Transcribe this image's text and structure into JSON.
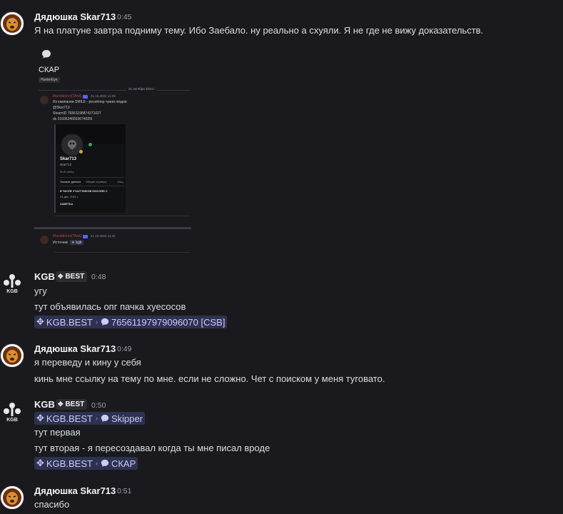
{
  "messages": [
    {
      "author": "Дядюшка Skar713",
      "time": "0:45",
      "lines": [
        "Я на платуне завтра подниму тему. Ибо Заебало. ну реально а схуяли. Я не где не вижу доказательств."
      ]
    },
    {
      "author": "KGB",
      "badge": "BEST",
      "time": "0:48",
      "lines": [
        "угу",
        "тут объявилась опг пачка хуесосов"
      ],
      "chip": {
        "server": "KGB.BEST",
        "channel": "76561197979096070 [CSB]"
      }
    },
    {
      "author": "Дядюшка Skar713",
      "time": "0:49",
      "lines": [
        "я переведу и кину у себя",
        "кинь мне ссылку на тему по мне. если не сложно. Чет с поиском у меня туговато."
      ]
    },
    {
      "author": "KGB",
      "badge": "BEST",
      "time": "0:50",
      "chip_top": {
        "server": "KGB.BEST",
        "channel": "Skipper"
      },
      "lines": [
        "тут первая",
        "тут вторая - я пересоздавал когда ты мне писал вроде"
      ],
      "chip": {
        "server": "KGB.BEST",
        "channel": "СКАР"
      }
    },
    {
      "author": "Дядюшка Skar713",
      "time": "0:51",
      "lines": [
        "спасибо"
      ]
    }
  ],
  "embed": {
    "channel_name": "СКАР",
    "tag": "HunterEye",
    "date_divider": "21 октября 2024 г.",
    "msg1_author": "Mandalorec[TAnk]",
    "msg1_time": "21.10.2024 11:09",
    "msg1_lines": [
      "Из кампании SMILE - ресейлер чужих модов",
      "@Skar713",
      "SteamID 76561198874371027",
      "ds 3193624656367452I6"
    ],
    "profile_name": "Skar713",
    "profile_handle": "skar713",
    "profile_sub": "Мой сабер",
    "profile_tabs": [
      "Личные данные",
      "Общие сервера",
      "Общ"
    ],
    "profile_members": "В ЧИСЛЕ УЧАСТНИКОВ DISCORD С",
    "profile_date": "21 дек. 2021 г.",
    "profile_note": "ЗАМЕТКА",
    "msg2_author": "Mandalorec[TAnk]",
    "msg2_time": "21.10.2024 11:32",
    "msg2_text": "Источник",
    "msg2_link": "kgb"
  },
  "colors": {
    "background": "#1a1a1e",
    "mention_bg": "#2e3250",
    "mention_text": "#c9cdfb"
  }
}
